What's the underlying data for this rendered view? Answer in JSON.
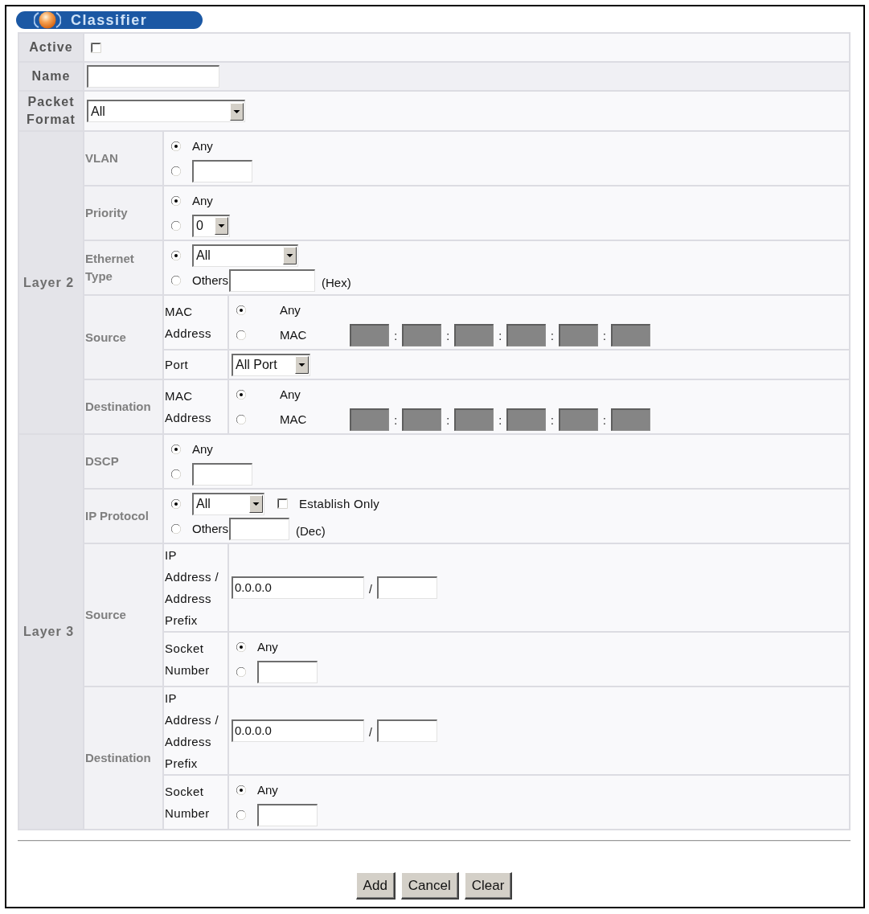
{
  "title": "Classifier",
  "general": [
    {
      "label": "Active",
      "lines": [
        [
          {
            "kind": "checkbox",
            "checked": false
          }
        ]
      ]
    },
    {
      "label": "Name",
      "lines": [
        [
          {
            "kind": "text",
            "disabled": false
          }
        ]
      ]
    },
    {
      "label": "Packet Format",
      "lines": [
        [
          {
            "kind": "select",
            "value": "All"
          }
        ]
      ]
    }
  ],
  "sections": [
    {
      "label": "Layer 2",
      "groups": [
        {
          "label": "VLAN",
          "fields": [
            {
              "kind": "options",
              "lines": [
                [
                  {
                    "kind": "radio",
                    "selected": true,
                    "label": "Any"
                  }
                ],
                [
                  {
                    "kind": "radio",
                    "selected": false
                  },
                  {
                    "kind": "text",
                    "disabled": false
                  }
                ]
              ]
            }
          ]
        },
        {
          "label": "Priority",
          "fields": [
            {
              "kind": "options",
              "lines": [
                [
                  {
                    "kind": "radio",
                    "selected": true,
                    "label": "Any"
                  }
                ],
                [
                  {
                    "kind": "radio",
                    "selected": false
                  },
                  {
                    "kind": "select",
                    "value": "0"
                  }
                ]
              ]
            }
          ]
        },
        {
          "label": "Ethernet Type",
          "fields": [
            {
              "kind": "options",
              "lines": [
                [
                  {
                    "kind": "radio",
                    "selected": true
                  },
                  {
                    "kind": "select",
                    "value": "All"
                  }
                ],
                [
                  {
                    "kind": "radio",
                    "selected": false,
                    "label": "Others"
                  },
                  {
                    "kind": "text",
                    "disabled": false
                  },
                  {
                    "kind": "note",
                    "text": "(Hex)"
                  }
                ]
              ]
            }
          ]
        },
        {
          "label": "Source",
          "fields": [
            {
              "kind": "mac",
              "label": "MAC Address",
              "lines": [
                [
                  {
                    "kind": "radio",
                    "selected": true,
                    "label": "Any"
                  }
                ],
                [
                  {
                    "kind": "radio",
                    "selected": false,
                    "label": "MAC"
                  },
                  {
                    "kind": "text",
                    "disabled": true
                  },
                  {
                    "kind": "sep",
                    "text": ":"
                  },
                  {
                    "kind": "text",
                    "disabled": true
                  },
                  {
                    "kind": "sep",
                    "text": ":"
                  },
                  {
                    "kind": "text",
                    "disabled": true
                  },
                  {
                    "kind": "sep",
                    "text": ":"
                  },
                  {
                    "kind": "text",
                    "disabled": true
                  },
                  {
                    "kind": "sep",
                    "text": ":"
                  },
                  {
                    "kind": "text",
                    "disabled": true
                  },
                  {
                    "kind": "sep",
                    "text": ":"
                  },
                  {
                    "kind": "text",
                    "disabled": true
                  }
                ]
              ]
            },
            {
              "kind": "select",
              "label": "Port",
              "lines": [
                [
                  {
                    "kind": "select",
                    "value": "All Port"
                  }
                ]
              ]
            }
          ]
        },
        {
          "label": "Destination",
          "fields": [
            {
              "kind": "mac",
              "label": "MAC Address",
              "lines": [
                [
                  {
                    "kind": "radio",
                    "selected": true,
                    "label": "Any"
                  }
                ],
                [
                  {
                    "kind": "radio",
                    "selected": false,
                    "label": "MAC"
                  },
                  {
                    "kind": "text",
                    "disabled": true
                  },
                  {
                    "kind": "sep",
                    "text": ":"
                  },
                  {
                    "kind": "text",
                    "disabled": true
                  },
                  {
                    "kind": "sep",
                    "text": ":"
                  },
                  {
                    "kind": "text",
                    "disabled": true
                  },
                  {
                    "kind": "sep",
                    "text": ":"
                  },
                  {
                    "kind": "text",
                    "disabled": true
                  },
                  {
                    "kind": "sep",
                    "text": ":"
                  },
                  {
                    "kind": "text",
                    "disabled": true
                  },
                  {
                    "kind": "sep",
                    "text": ":"
                  },
                  {
                    "kind": "text",
                    "disabled": true
                  }
                ]
              ]
            }
          ]
        }
      ]
    },
    {
      "label": "Layer 3",
      "groups": [
        {
          "label": "DSCP",
          "fields": [
            {
              "kind": "options",
              "lines": [
                [
                  {
                    "kind": "radio",
                    "selected": true,
                    "label": "Any"
                  }
                ],
                [
                  {
                    "kind": "radio",
                    "selected": false
                  },
                  {
                    "kind": "text",
                    "disabled": false
                  }
                ]
              ]
            }
          ]
        },
        {
          "label": "IP Protocol",
          "fields": [
            {
              "kind": "options",
              "lines": [
                [
                  {
                    "kind": "radio",
                    "selected": true
                  },
                  {
                    "kind": "select",
                    "value": "All"
                  },
                  {
                    "kind": "checkbox",
                    "checked": false,
                    "label": "Establish Only"
                  }
                ],
                [
                  {
                    "kind": "radio",
                    "selected": false,
                    "label": "Others"
                  },
                  {
                    "kind": "text",
                    "disabled": false
                  },
                  {
                    "kind": "note",
                    "text": "(Dec)"
                  }
                ]
              ]
            }
          ]
        },
        {
          "label": "Source",
          "fields": [
            {
              "kind": "address",
              "label": "IP Address / Address Prefix",
              "lines": [
                [
                  {
                    "kind": "text",
                    "disabled": false,
                    "value": "0.0.0.0"
                  },
                  {
                    "kind": "sep",
                    "text": "/"
                  },
                  {
                    "kind": "text",
                    "disabled": false
                  }
                ]
              ]
            },
            {
              "kind": "options",
              "label": "Socket Number",
              "lines": [
                [
                  {
                    "kind": "radio",
                    "selected": true,
                    "label": "Any"
                  }
                ],
                [
                  {
                    "kind": "radio",
                    "selected": false
                  },
                  {
                    "kind": "text",
                    "disabled": false
                  }
                ]
              ]
            }
          ]
        },
        {
          "label": "Destination",
          "fields": [
            {
              "kind": "address",
              "label": "IP Address / Address Prefix",
              "lines": [
                [
                  {
                    "kind": "text",
                    "disabled": false,
                    "value": "0.0.0.0"
                  },
                  {
                    "kind": "sep",
                    "text": "/"
                  },
                  {
                    "kind": "text",
                    "disabled": false
                  }
                ]
              ]
            },
            {
              "kind": "options",
              "label": "Socket Number",
              "lines": [
                [
                  {
                    "kind": "radio",
                    "selected": true,
                    "label": "Any"
                  }
                ],
                [
                  {
                    "kind": "radio",
                    "selected": false
                  },
                  {
                    "kind": "text",
                    "disabled": false
                  }
                ]
              ]
            }
          ]
        }
      ]
    }
  ],
  "buttons": [
    "Add",
    "Cancel",
    "Clear"
  ]
}
